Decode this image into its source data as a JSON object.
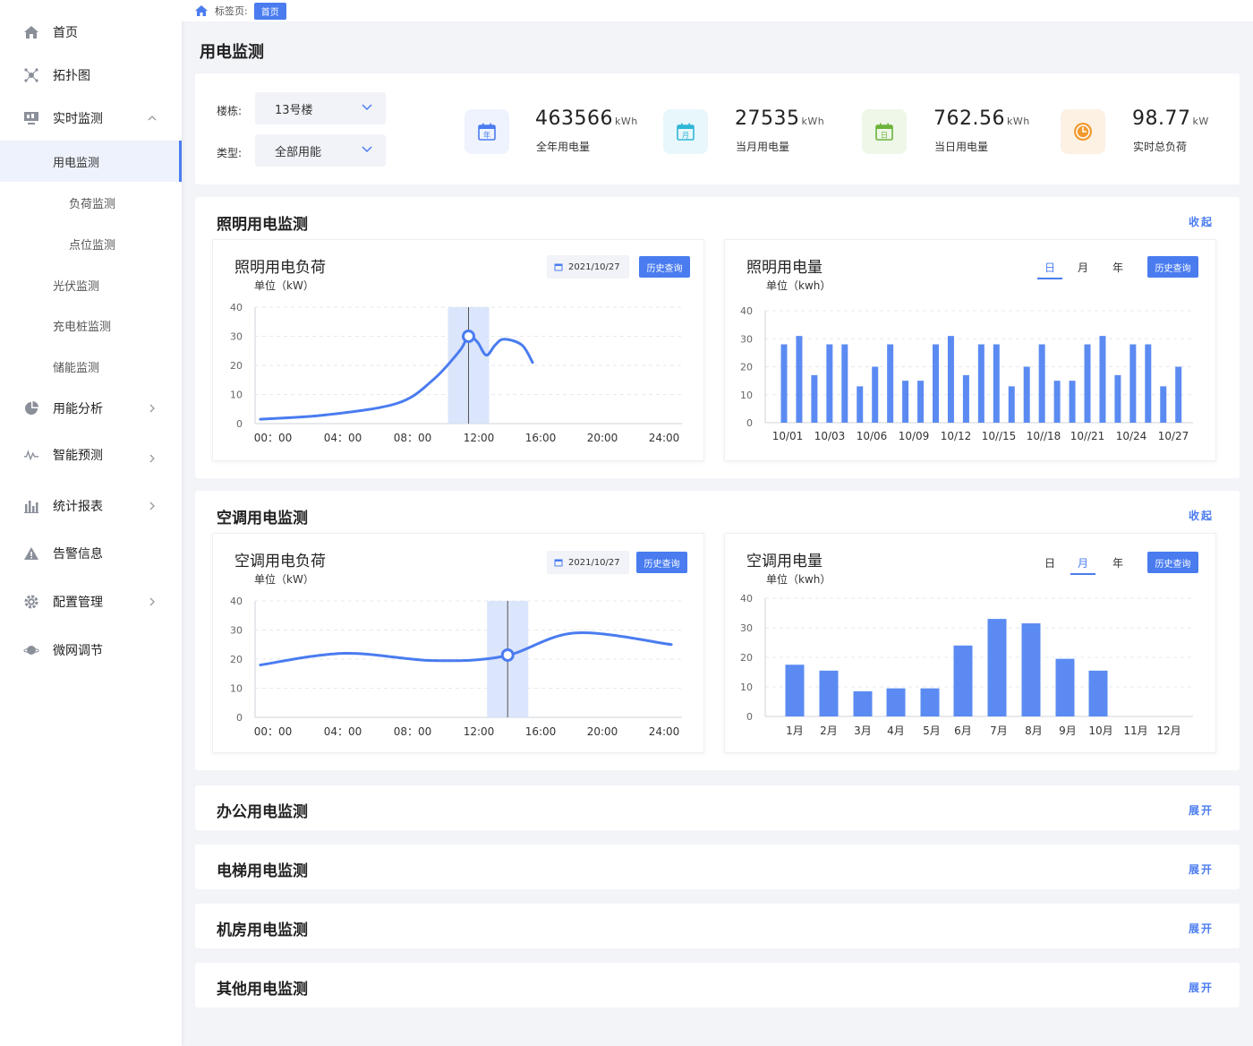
{
  "sidebar": {
    "items": [
      {
        "label": "首页",
        "icon": "home-icon"
      },
      {
        "label": "拓扑图",
        "icon": "topology-icon"
      },
      {
        "label": "实时监测",
        "icon": "monitor-icon"
      },
      {
        "label": "用能分析",
        "icon": "pie-chart-icon"
      },
      {
        "label": "智能预测",
        "icon": "trend-icon"
      },
      {
        "label": "统计报表",
        "icon": "bar-chart-icon"
      },
      {
        "label": "告警信息",
        "icon": "warning-icon"
      },
      {
        "label": "配置管理",
        "icon": "gear-icon"
      },
      {
        "label": "微网调节",
        "icon": "planet-icon"
      }
    ],
    "sub_items": [
      "用电监测",
      "负荷监测",
      "点位监测",
      "光伏监测",
      "充电桩监测",
      "储能监测"
    ]
  },
  "breadcrumb": {
    "label": "标签页:",
    "tag": "首页"
  },
  "page": {
    "title": "用电监测"
  },
  "filters": {
    "building_label": "楼栋:",
    "building_value": "13号楼",
    "type_label": "类型:",
    "type_value": "全部用能"
  },
  "stats": [
    {
      "value": "463566",
      "unit": "kWh",
      "label": "全年用电量",
      "icon_text": "年",
      "color": "#4a7cf0",
      "bg": "#eef3fd"
    },
    {
      "value": "27535",
      "unit": "kWh",
      "label": "当月用电量",
      "icon_text": "月",
      "color": "#2fb6d6",
      "bg": "#e8f7fb"
    },
    {
      "value": "762.56",
      "unit": "kWh",
      "label": "当日用电量",
      "icon_text": "日",
      "color": "#6bb43a",
      "bg": "#eef7e8"
    },
    {
      "value": "98.77",
      "unit": "kW",
      "label": "实时总负荷",
      "icon_text": "",
      "color": "#f29a2e",
      "bg": "#fdf1e4"
    }
  ],
  "sections": {
    "lighting": {
      "title": "照明用电监测",
      "toggle": "收起",
      "load": {
        "title": "照明用电负荷",
        "unit": "单位（kW）",
        "date": "2021/10/27",
        "button": "历史查询"
      },
      "energy": {
        "title": "照明用电量",
        "unit": "单位（kwh）",
        "tabs": [
          "日",
          "月",
          "年"
        ],
        "active_tab": "日",
        "button": "历史查询"
      }
    },
    "ac": {
      "title": "空调用电监测",
      "toggle": "收起",
      "load": {
        "title": "空调用电负荷",
        "unit": "单位（kW）",
        "date": "2021/10/27",
        "button": "历史查询"
      },
      "energy": {
        "title": "空调用电量",
        "unit": "单位（kwh）",
        "tabs": [
          "日",
          "月",
          "年"
        ],
        "active_tab": "月",
        "button": "历史查询"
      }
    },
    "collapsed": [
      {
        "title": "办公用电监测",
        "toggle": "展开"
      },
      {
        "title": "电梯用电监测",
        "toggle": "展开"
      },
      {
        "title": "机房用电监测",
        "toggle": "展开"
      },
      {
        "title": "其他用电监测",
        "toggle": "展开"
      }
    ]
  },
  "chart_data": [
    {
      "id": "lighting-load",
      "type": "line",
      "x_ticks": [
        "00：00",
        "04：00",
        "08：00",
        "12:00",
        "16:00",
        "20:00",
        "24:00"
      ],
      "x_hours": [
        0.3,
        4,
        8,
        10,
        11.5,
        12,
        12.5,
        13,
        13.5,
        14,
        15,
        15.6
      ],
      "y": [
        1.5,
        3,
        7,
        15,
        25,
        30,
        28,
        23.5,
        27,
        29,
        27,
        21
      ],
      "highlight_hour": 12,
      "ylim": [
        0,
        40
      ],
      "yticks": [
        0,
        10,
        20,
        30,
        40
      ],
      "xlim": [
        0,
        24
      ]
    },
    {
      "id": "lighting-energy",
      "type": "bar",
      "x_ticks": [
        "10/01",
        "10/03",
        "10/06",
        "10/09",
        "10/12",
        "10//15",
        "10//18",
        "10//21",
        "10/24",
        "10/27"
      ],
      "values": [
        28,
        31,
        17,
        28,
        28,
        13,
        20,
        28,
        15,
        15,
        28,
        31,
        17,
        28,
        28,
        13,
        20,
        28,
        15,
        15,
        28,
        31,
        17,
        28,
        28,
        13,
        20
      ],
      "ylim": [
        0,
        40
      ],
      "yticks": [
        0,
        10,
        20,
        30,
        40
      ]
    },
    {
      "id": "ac-load",
      "type": "line",
      "x_ticks": [
        "00：00",
        "04：00",
        "08：00",
        "12:00",
        "16:00",
        "20:00",
        "24:00"
      ],
      "x_hours": [
        0.3,
        5,
        10,
        14,
        18,
        23.4
      ],
      "y": [
        18,
        22,
        19.5,
        21,
        29,
        25
      ],
      "highlight_hour": 14.2,
      "ylim": [
        0,
        40
      ],
      "yticks": [
        0,
        10,
        20,
        30,
        40
      ],
      "xlim": [
        0,
        24
      ]
    },
    {
      "id": "ac-energy",
      "type": "bar",
      "categories": [
        "1月",
        "2月",
        "3月",
        "4月",
        "5月",
        "6月",
        "7月",
        "8月",
        "9月",
        "10月",
        "11月",
        "12月"
      ],
      "values": [
        17.5,
        15.5,
        8.5,
        9.5,
        9.5,
        24,
        33,
        31.5,
        19.5,
        15.5,
        null,
        null
      ],
      "ylim": [
        0,
        40
      ],
      "yticks": [
        0,
        10,
        20,
        30,
        40
      ]
    }
  ]
}
